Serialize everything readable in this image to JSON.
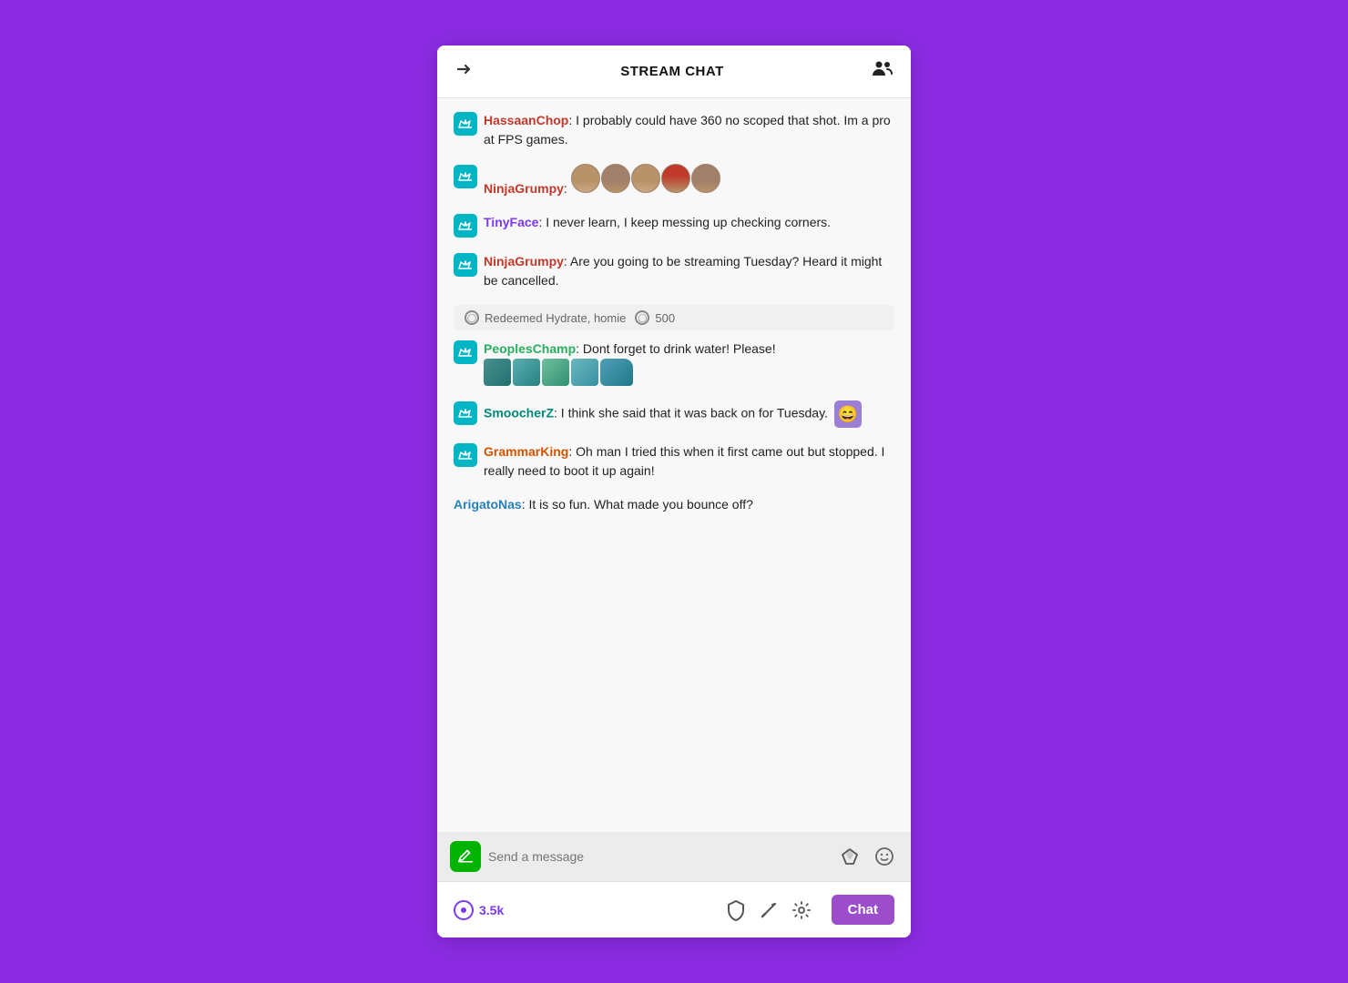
{
  "header": {
    "title": "STREAM CHAT",
    "collapse_label": "collapse",
    "users_label": "users"
  },
  "messages": [
    {
      "id": "msg1",
      "username": "HassaanChop",
      "username_color": "red",
      "has_crown": true,
      "text": ": I probably could have 360 no scoped that shot. Im a pro at FPS games.",
      "has_emotes": false,
      "emote_count": 0
    },
    {
      "id": "msg2",
      "username": "NinjaGrumpy",
      "username_color": "red",
      "has_crown": true,
      "text": ":",
      "has_emotes": true,
      "emote_count": 5
    },
    {
      "id": "msg3",
      "username": "TinyFace",
      "username_color": "purple",
      "has_crown": true,
      "text": ": I never learn, I keep messing up checking corners.",
      "has_emotes": false
    },
    {
      "id": "msg4",
      "username": "NinjaGrumpy",
      "username_color": "red",
      "has_crown": true,
      "text": ": Are you going to be streaming Tuesday? Heard it might be cancelled.",
      "has_emotes": false
    }
  ],
  "redemption": {
    "text": "Redeemed Hydrate, homie",
    "points": "500"
  },
  "messages2": [
    {
      "id": "msg5",
      "username": "PeoplesChamp",
      "username_color": "green",
      "has_crown": true,
      "text": ": Dont forget to drink water! Please!",
      "has_emotes": true,
      "emote_type": "drink"
    },
    {
      "id": "msg6",
      "username": "SmoocherZ",
      "username_color": "teal",
      "has_crown": true,
      "text": ": I think she said that it was back on for Tuesday.",
      "has_emotes": true,
      "emote_type": "laugh"
    },
    {
      "id": "msg7",
      "username": "GrammarKing",
      "username_color": "orange",
      "has_crown": true,
      "text": ": Oh man I tried this when it first came out but stopped. I really need to boot it up again!",
      "has_emotes": false
    },
    {
      "id": "msg8",
      "username": "ArigatoNas",
      "username_color": "blue",
      "has_crown": false,
      "text": ": It is so fun. What made you bounce off?",
      "has_emotes": false
    }
  ],
  "input": {
    "placeholder": "Send a message"
  },
  "bottom_bar": {
    "viewer_count": "3.5k",
    "chat_button": "Chat"
  }
}
